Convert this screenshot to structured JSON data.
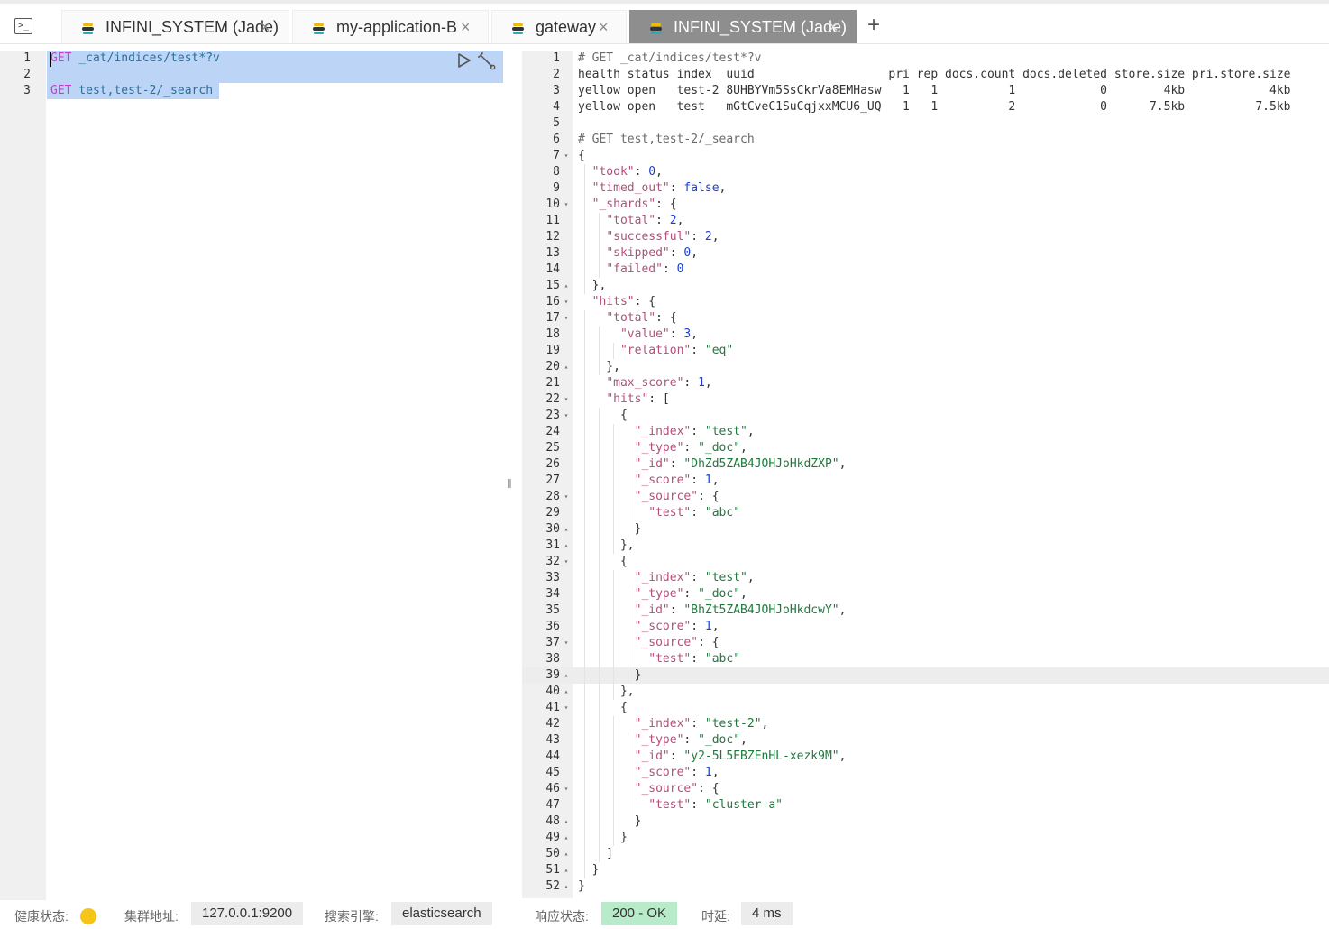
{
  "colors": {
    "health": "#f5c518",
    "ok_chip": "#b7ebc9",
    "selection": "#bcd5f7"
  },
  "tabs": [
    {
      "label": "INFINI_SYSTEM (Jade)",
      "icon": "elasticsearch-icon",
      "active": false
    },
    {
      "label": "my-application-B",
      "icon": "elasticsearch-icon",
      "active": false
    },
    {
      "label": "gateway",
      "icon": "elasticsearch-icon",
      "active": false
    },
    {
      "label": "INFINI_SYSTEM (Jade)",
      "icon": "elasticsearch-icon",
      "active": true
    }
  ],
  "close_glyph": "×",
  "add_glyph": "+",
  "console_glyph": ">_",
  "divider_glyph": "‖",
  "editor": {
    "line_numbers": [
      "1",
      "2",
      "3"
    ],
    "req1_method": "GET",
    "req1_path": " _cat/indices/test*?v",
    "req2_method": "GET",
    "req2_path": " test,test-2/_search"
  },
  "output": {
    "line_numbers": [
      "1",
      "2",
      "3",
      "4",
      "5",
      "6",
      "7",
      "8",
      "9",
      "10",
      "11",
      "12",
      "13",
      "14",
      "15",
      "16",
      "17",
      "18",
      "19",
      "20",
      "21",
      "22",
      "23",
      "24",
      "25",
      "26",
      "27",
      "28",
      "29",
      "30",
      "31",
      "32",
      "33",
      "34",
      "35",
      "36",
      "37",
      "38",
      "39",
      "40",
      "41",
      "42",
      "43",
      "44",
      "45",
      "46",
      "47",
      "48",
      "49",
      "50",
      "51",
      "52"
    ],
    "comment1": "# GET _cat/indices/test*?v",
    "cat_header": "health status index  uuid                   pri rep docs.count docs.deleted store.size pri.store.size",
    "cat_row1": "yellow open   test-2 8UHBYVm5SsCkrVa8EMHasw   1   1          1            0        4kb            4kb",
    "cat_row2": "yellow open   test   mGtCveC1SuCqjxxMCU6_UQ   1   1          2            0      7.5kb          7.5kb",
    "comment2": "# GET test,test-2/_search",
    "took": "0",
    "timed_out": "false",
    "shards": {
      "total": "2",
      "successful": "2",
      "skipped": "0",
      "failed": "0"
    },
    "hits_total": {
      "value": "3",
      "relation": "\"eq\""
    },
    "max_score": "1",
    "docs": [
      {
        "index": "\"test\"",
        "type": "\"_doc\"",
        "id": "\"DhZd5ZAB4JOHJoHkdZXP\"",
        "score": "1",
        "test": "\"abc\""
      },
      {
        "index": "\"test\"",
        "type": "\"_doc\"",
        "id": "\"BhZt5ZAB4JOHJoHkdcwY\"",
        "score": "1",
        "test": "\"abc\""
      },
      {
        "index": "\"test-2\"",
        "type": "\"_doc\"",
        "id": "\"y2-5L5EBZEnHL-xezk9M\"",
        "score": "1",
        "test": "\"cluster-a\""
      }
    ]
  },
  "status": {
    "health_label": "健康状态:",
    "cluster_label": "集群地址:",
    "cluster_value": "127.0.0.1:9200",
    "engine_label": "搜索引擎:",
    "engine_value": "elasticsearch",
    "response_label": "响应状态:",
    "response_value": "200 - OK",
    "latency_label": "时延:",
    "latency_value": "4 ms"
  }
}
